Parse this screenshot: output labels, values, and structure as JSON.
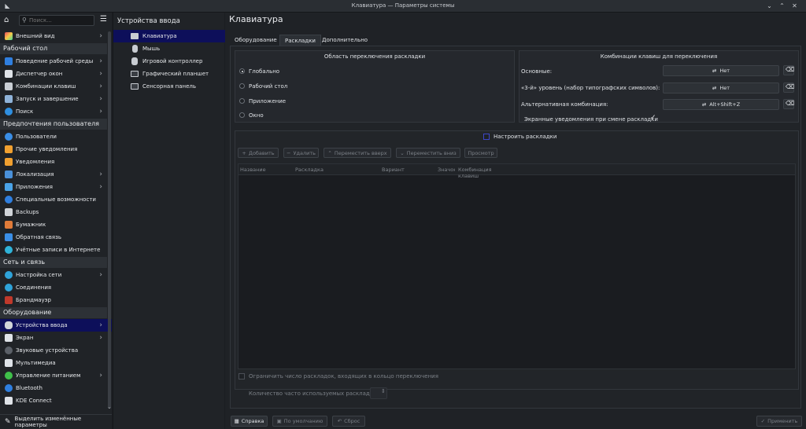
{
  "window": {
    "title": "Клавиатура — Параметры системы"
  },
  "search": {
    "placeholder": "Поиск..."
  },
  "sidebar": {
    "item_appearance": "Внешний вид",
    "sec_workspace": "Рабочий стол",
    "item_desktop_behavior": "Поведение рабочей среды",
    "item_window_manager": "Диспетчер окон",
    "item_shortcuts": "Комбинации клавиш",
    "item_startup": "Запуск и завершение",
    "item_search": "Поиск",
    "sec_personalization": "Предпочтения пользователя",
    "item_users": "Пользователи",
    "item_other_notifications": "Прочие уведомления",
    "item_notifications": "Уведомления",
    "item_locale": "Локализация",
    "item_applications": "Приложения",
    "item_accessibility": "Специальные возможности",
    "item_backups": "Backups",
    "item_wallet": "Бумажник",
    "item_feedback": "Обратная связь",
    "item_online_accounts": "Учётные записи в Интернете",
    "sec_network": "Сеть и связь",
    "item_network_settings": "Настройка сети",
    "item_connections": "Соединения",
    "item_firewall": "Брандмауэр",
    "sec_hardware": "Оборудование",
    "item_input_devices": "Устройства ввода",
    "item_display": "Экран",
    "item_audio": "Звуковые устройства",
    "item_multimedia": "Мультимедиа",
    "item_power": "Управление питанием",
    "item_bluetooth": "Bluetooth",
    "item_kdeconnect": "KDE Connect",
    "highlight_changed": "Выделить изменённые параметры"
  },
  "subnav": {
    "title": "Устройства ввода",
    "keyboard": "Клавиатура",
    "mouse": "Мышь",
    "gamepad": "Игровой контроллер",
    "tablet": "Графический планшет",
    "touchpad": "Сенсорная панель"
  },
  "page": {
    "title": "Клавиатура"
  },
  "tabs": {
    "hardware": "Оборудование",
    "layouts": "Раскладки",
    "advanced": "Дополнительно"
  },
  "switching": {
    "title": "Область переключения раскладки",
    "global": "Глобально",
    "desktop": "Рабочий стол",
    "application": "Приложение",
    "window": "Окно"
  },
  "shortcuts": {
    "title": "Комбинации клавиш для переключения",
    "main_label": "Основные:",
    "main_value": "Нет",
    "third_label": "«3-й» уровень (набор типографских символов):",
    "third_value": "Нет",
    "alt_label": "Альтернативная комбинация:",
    "alt_value": "Alt+Shift+Z",
    "osd_label": "Экранные уведомления при смене раскладки"
  },
  "layouts": {
    "configure_label": "Настроить раскладки",
    "add": "Добавить",
    "remove": "Удалить",
    "move_up": "Переместить вверх",
    "move_down": "Переместить вниз",
    "preview": "Просмотр",
    "col_name": "Название",
    "col_layout": "Раскладка",
    "col_variant": "Вариант",
    "col_label": "Значок",
    "col_shortcut": "Комбинация клавиш",
    "limit_label": "Ограничить число раскладок, входящих в кольцо переключения",
    "spare_label": "Количество часто используемых раскладок:"
  },
  "footer": {
    "help": "Справка",
    "defaults": "По умолчанию",
    "reset": "Сброс",
    "apply": "Применить"
  },
  "colors": {
    "selection": "#0d0f5a",
    "background": "#1b1e22",
    "panel": "#25282d"
  }
}
